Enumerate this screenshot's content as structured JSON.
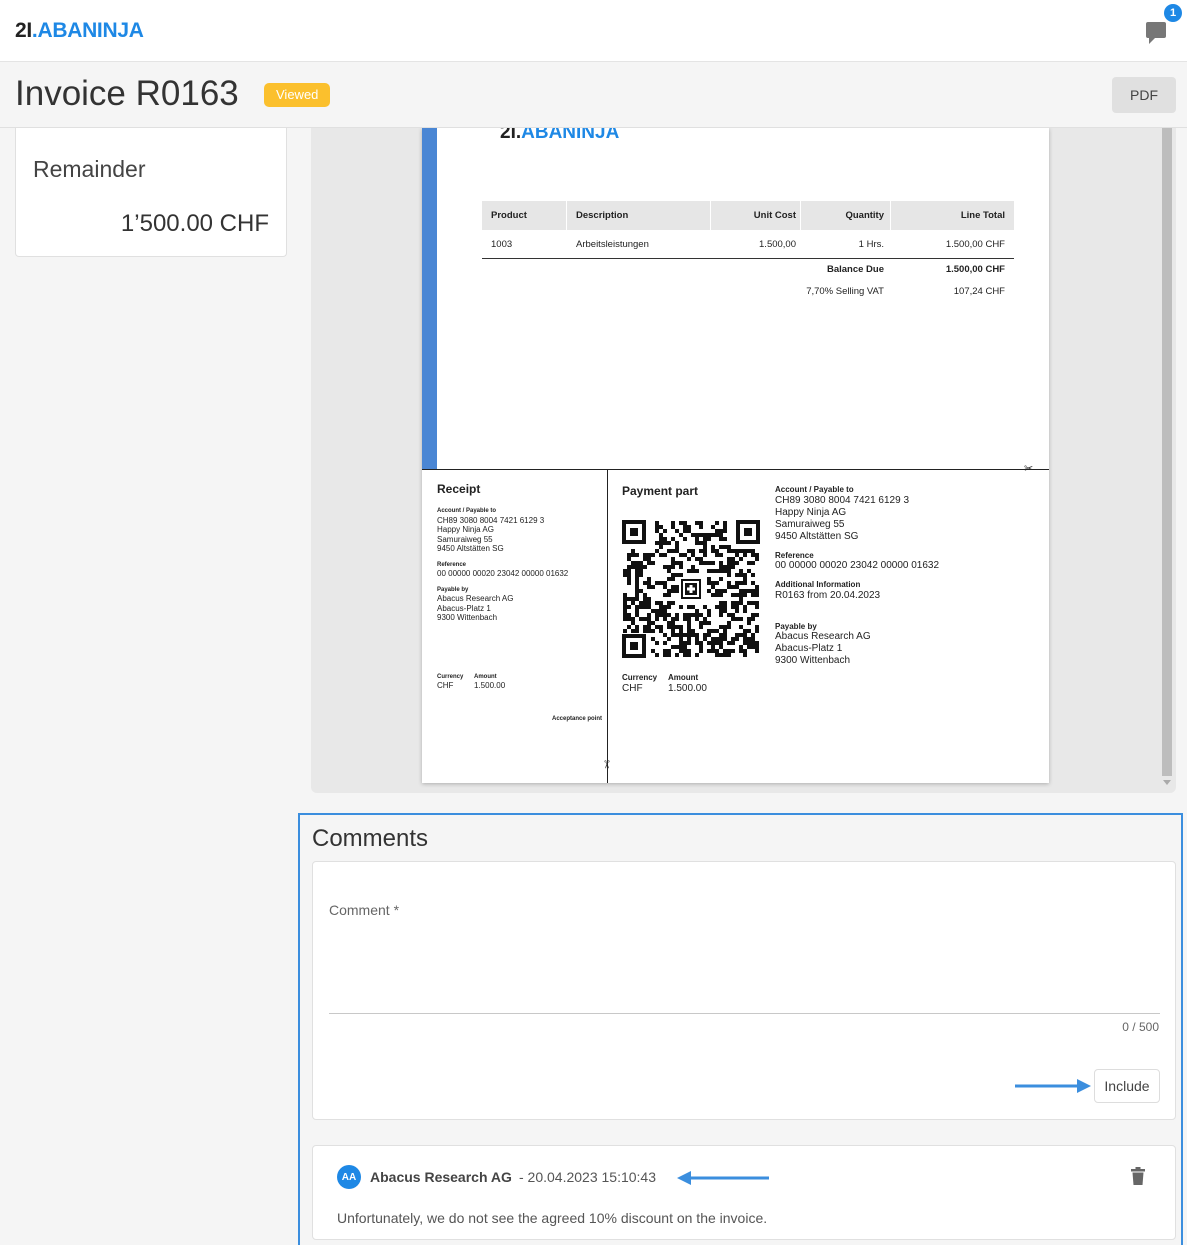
{
  "header": {
    "logo_mark": "2I",
    "logo_dot": ".",
    "logo_name": "ABANINJA",
    "notification_count": "1"
  },
  "title_bar": {
    "title": "Invoice R0163",
    "status": "Viewed",
    "pdf_label": "PDF"
  },
  "summary": {
    "label": "Remainder",
    "value": "1’500.00 CHF"
  },
  "document": {
    "logo_mark": "2I.",
    "logo_name": "ABANINJA",
    "columns": [
      "Product",
      "Description",
      "Unit Cost",
      "Quantity",
      "Line Total"
    ],
    "rows": [
      [
        "1003",
        "Arbeitsleistungen",
        "1.500,00",
        "1 Hrs.",
        "1.500,00 CHF"
      ]
    ],
    "balance_due_label": "Balance Due",
    "balance_due_value": "1.500,00 CHF",
    "vat_label": "7,70% Selling VAT",
    "vat_value": "107,24 CHF",
    "receipt": {
      "heading": "Receipt",
      "account_label": "Account / Payable to",
      "account_lines": [
        "CH89 3080 8004 7421 6129 3",
        "Happy Ninja AG",
        "Samuraiweg 55",
        "9450 Altstätten SG"
      ],
      "reference_label": "Reference",
      "reference": "00 00000 00020 23042 00000 01632",
      "payable_by_label": "Payable by",
      "payable_by_lines": [
        "Abacus Research AG",
        "Abacus-Platz 1",
        "9300 Wittenbach"
      ],
      "currency_label": "Currency",
      "currency": "CHF",
      "amount_label": "Amount",
      "amount": "1.500.00",
      "acceptance_label": "Acceptance point"
    },
    "payment": {
      "heading": "Payment part",
      "account_label": "Account / Payable to",
      "account_lines": [
        "CH89 3080 8004 7421 6129 3",
        "Happy Ninja AG",
        "Samuraiweg 55",
        "9450 Altstätten SG"
      ],
      "reference_label": "Reference",
      "reference": "00 00000 00020 23042 00000 01632",
      "info_label": "Additional Information",
      "info": "R0163 from 20.04.2023",
      "payable_by_label": "Payable by",
      "payable_by_lines": [
        "Abacus Research AG",
        "Abacus-Platz 1",
        "9300 Wittenbach"
      ],
      "currency_label": "Currency",
      "currency": "CHF",
      "amount_label": "Amount",
      "amount": "1.500.00"
    }
  },
  "comments": {
    "title": "Comments",
    "field_label": "Comment *",
    "counter": "0 / 500",
    "submit_label": "Include",
    "items": [
      {
        "initials": "AA",
        "author": "Abacus Research AG",
        "timestamp": "- 20.04.2023 15:10:43",
        "text": "Unfortunately, we do not see the agreed 10% discount on the invoice."
      }
    ]
  },
  "colors": {
    "accent": "#1e88e5",
    "status_viewed": "#fbc02d",
    "highlight_border": "#3b8ede"
  }
}
